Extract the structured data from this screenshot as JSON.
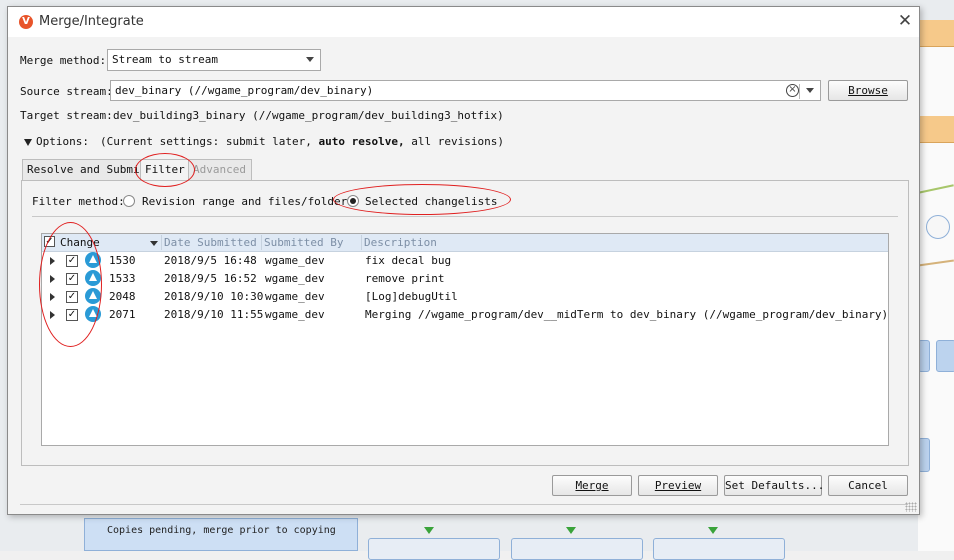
{
  "background": {
    "note_text": "Copies pending, merge prior to copying"
  },
  "dialog": {
    "title": "Merge/Integrate",
    "logo_letter": "V",
    "close_glyph": "✕"
  },
  "merge_method": {
    "label": "Merge method:",
    "value": "Stream to stream"
  },
  "source_stream": {
    "label": "Source stream:",
    "value": "dev_binary (//wgame_program/dev_binary)",
    "browse_label": "Browse"
  },
  "target_stream": {
    "label": "Target stream:",
    "value": "dev_building3_binary (//wgame_program/dev_building3_hotfix)"
  },
  "options": {
    "label": "Options:",
    "settings_prefix": "(Current settings: submit later,",
    "settings_bold": "auto resolve,",
    "settings_suffix": "all revisions)"
  },
  "tabs": [
    {
      "label": "Resolve and Submit",
      "state": "normal"
    },
    {
      "label": "Filter",
      "state": "active"
    },
    {
      "label": "Advanced",
      "state": "disabled"
    }
  ],
  "filter": {
    "method_label": "Filter method:",
    "options": [
      {
        "label": "Revision range and files/folders",
        "selected": false
      },
      {
        "label": "Selected changelists",
        "selected": true
      }
    ]
  },
  "table": {
    "columns": [
      "Change",
      "Date Submitted",
      "Submitted By",
      "Description"
    ],
    "rows": [
      {
        "change": "1530",
        "date": "2018/9/5 16:48",
        "user": "wgame_dev",
        "description": "fix decal bug",
        "checked": true
      },
      {
        "change": "1533",
        "date": "2018/9/5 16:52",
        "user": "wgame_dev",
        "description": "remove print",
        "checked": true
      },
      {
        "change": "2048",
        "date": "2018/9/10 10:30",
        "user": "wgame_dev",
        "description": "[Log]debugUtil",
        "checked": true
      },
      {
        "change": "2071",
        "date": "2018/9/10 11:55",
        "user": "wgame_dev",
        "description": "Merging //wgame_program/dev__midTerm to dev_binary (//wgame_program/dev_binary)",
        "checked": true
      }
    ]
  },
  "buttons": {
    "merge": "Merge",
    "preview": "Preview",
    "set_defaults": "Set Defaults...",
    "cancel": "Cancel"
  },
  "colors": {
    "accent": "#3e8fd6",
    "annotation_red": "#e02020",
    "logo": "#e8542a",
    "changelist_icon": "#2a9ad6"
  }
}
